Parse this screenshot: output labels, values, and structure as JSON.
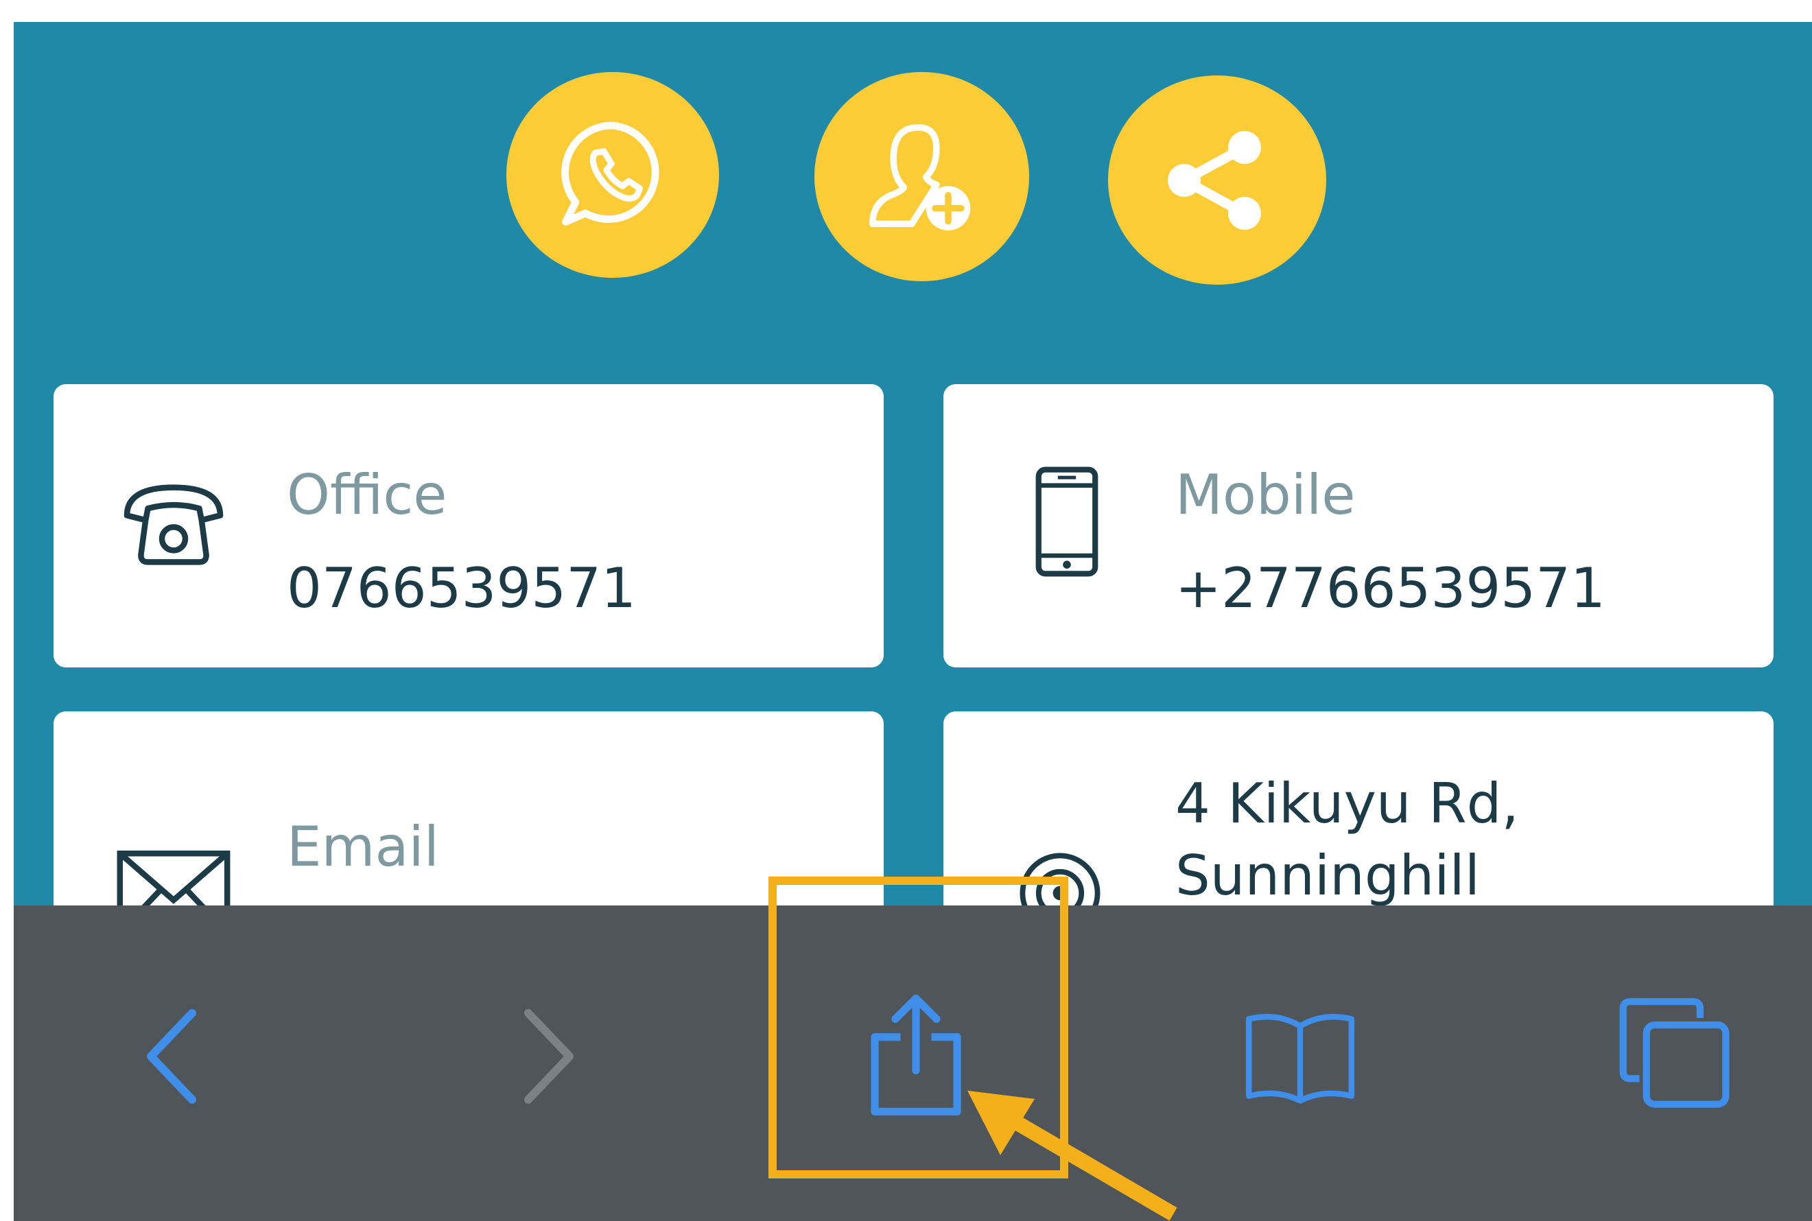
{
  "colors": {
    "page_bg": "#2189a8",
    "action_yellow": "#fccc37",
    "card_bg": "#ffffff",
    "label_gray": "#7f99a1",
    "value_dark": "#1d3b47",
    "toolbar_bg": "#4f5559",
    "ios_blue": "#3f8eea",
    "disabled_gray": "#7b8185",
    "highlight": "#f3b01a"
  },
  "actions": [
    {
      "id": "whatsapp",
      "icon": "whatsapp-icon"
    },
    {
      "id": "add_contact",
      "icon": "add-contact-icon"
    },
    {
      "id": "share",
      "icon": "share-icon"
    }
  ],
  "contact": {
    "office": {
      "label": "Office",
      "value": "0766539571",
      "icon": "telephone-icon"
    },
    "mobile": {
      "label": "Mobile",
      "value": "+27766539571",
      "icon": "mobile-phone-icon"
    },
    "email": {
      "label": "Email",
      "icon": "envelope-icon"
    },
    "address": {
      "line1": "4 Kikuyu Rd,",
      "line2": "Sunninghill",
      "icon": "location-icon"
    }
  },
  "toolbar": {
    "back": {
      "icon": "chevron-left-icon",
      "enabled": true
    },
    "forward": {
      "icon": "chevron-right-icon",
      "enabled": false
    },
    "share": {
      "icon": "share-box-icon",
      "highlighted": true
    },
    "bookmarks": {
      "icon": "open-book-icon"
    },
    "tabs": {
      "icon": "tabs-icon"
    }
  }
}
